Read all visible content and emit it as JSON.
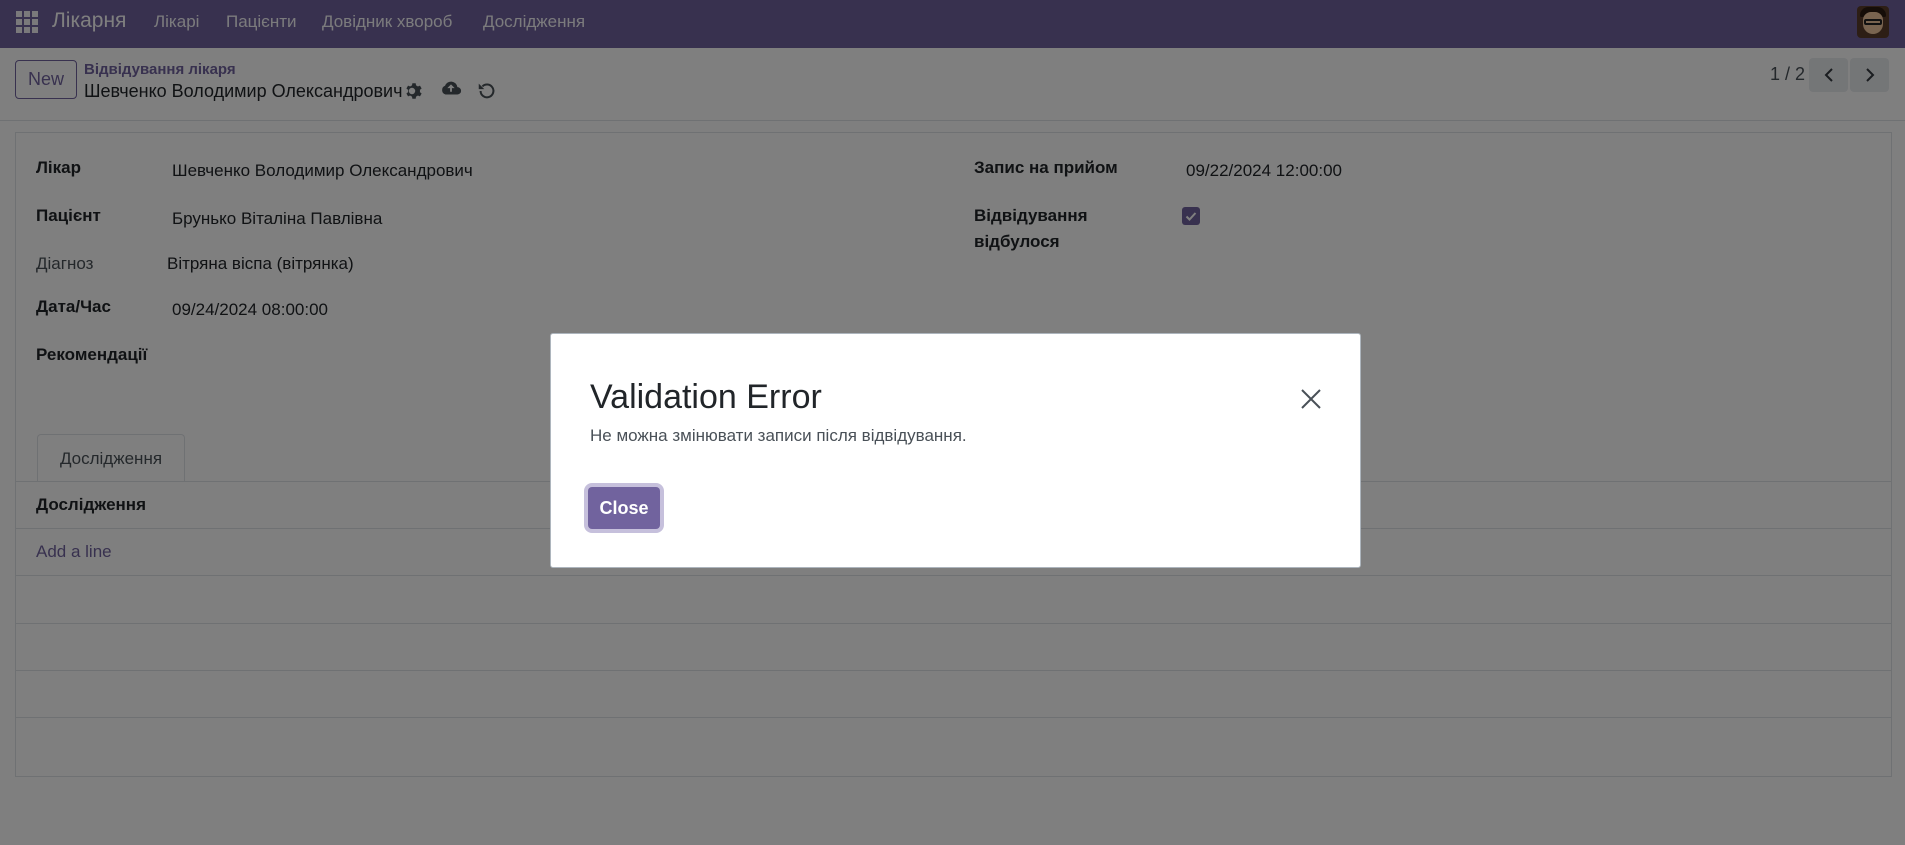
{
  "navbar": {
    "app_title": "Лікарня",
    "menu": [
      "Лікарі",
      "Пацієнти",
      "Довідник хвороб",
      "Дослідження"
    ],
    "color": "#71639e"
  },
  "control_panel": {
    "new_label": "New",
    "breadcrumb_parent": "Відвідування лікаря",
    "breadcrumb_current": "Шевченко Володимир Олександрович",
    "pager": "1 / 2"
  },
  "form": {
    "doctor_label": "Лікар",
    "doctor_value": "Шевченко Володимир Олександрович",
    "patient_label": "Пацієнт",
    "patient_value": "Брунько Віталіна Павлівна",
    "diagnosis_label": "Діагноз",
    "diagnosis_value": "Вітряна віспа (вітрянка)",
    "datetime_label": "Дата/Час",
    "datetime_value": "09/24/2024 08:00:00",
    "recommendations_label": "Рекомендації",
    "appointment_label": "Запис на прийом",
    "appointment_value": "09/22/2024 12:00:00",
    "visit_done_label_1": "Відвідування",
    "visit_done_label_2": "відбулося",
    "visit_done": true
  },
  "tabs": {
    "research_tab": "Дослідження",
    "list_header": "Дослідження",
    "add_line": "Add a line"
  },
  "modal": {
    "title": "Validation Error",
    "message": "Не можна змінювати записи після відвідування.",
    "close_label": "Close"
  }
}
